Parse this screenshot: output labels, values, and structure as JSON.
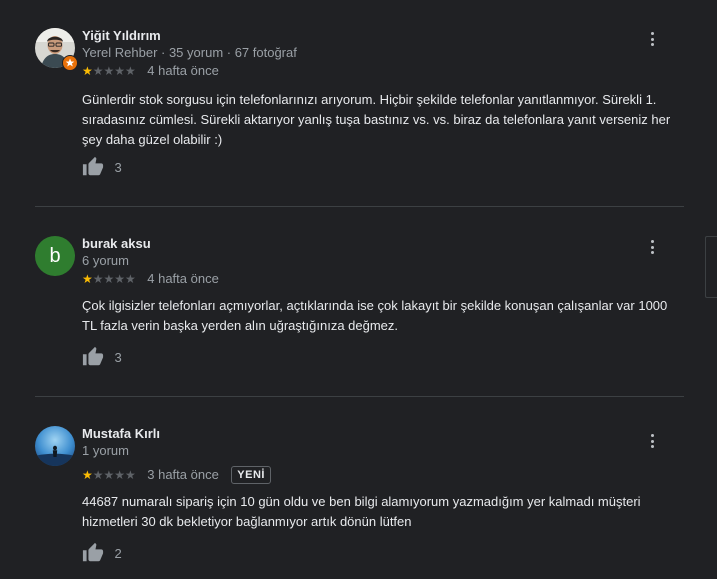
{
  "reviews": [
    {
      "author": "Yiğit Yıldırım",
      "meta": "Yerel Rehber · 35 yorum · 67 fotoğraf",
      "stars_filled": 1,
      "stars_total": 5,
      "date": "4 hafta önce",
      "new_badge": "",
      "text": "Günlerdir stok sorgusu için telefonlarınızı arıyorum. Hiçbir şekilde telefonlar yanıtlanmıyor. Sürekli 1. sıradasınız cümlesi. Sürekli aktarıyor yanlış tuşa bastınız vs. vs. biraz da telefonlara yanıt verseniz her şey daha güzel olabilir :)",
      "likes": "3",
      "avatar_type": "photo"
    },
    {
      "author": "burak aksu",
      "meta": "6 yorum",
      "stars_filled": 1,
      "stars_total": 5,
      "date": "4 hafta önce",
      "new_badge": "",
      "text": "Çok ilgisizler telefonları açmıyorlar, açtıklarında ise çok lakayıt bir şekilde konuşan çalışanlar var 1000 TL fazla verin başka yerden alın  uğraştığınıza değmez.",
      "likes": "3",
      "avatar_type": "letter",
      "avatar_letter": "b",
      "avatar_color": "#2f7d2f"
    },
    {
      "author": "Mustafa Kırlı",
      "meta": "1 yorum",
      "stars_filled": 1,
      "stars_total": 5,
      "date": "3 hafta önce",
      "new_badge": "YENİ",
      "text": "44687 numaralı sipariş için 10 gün oldu ve ben bilgi alamıyorum yazmadığım yer kalmadı müşteri hizmetleri 30 dk bekletiyor bağlanmıyor artık dönün lütfen",
      "likes": "2",
      "avatar_type": "photo"
    }
  ],
  "colors": {
    "background": "#202124",
    "star_filled": "#fbbc04",
    "star_empty": "#5f6368",
    "secondary_text": "#9aa0a6",
    "primary_text": "#e8eaed",
    "guide_badge": "#e8710a"
  },
  "icons": {
    "menu": "more-vert-icon",
    "like": "thumb-up-icon",
    "guide": "local-guide-badge-icon"
  }
}
